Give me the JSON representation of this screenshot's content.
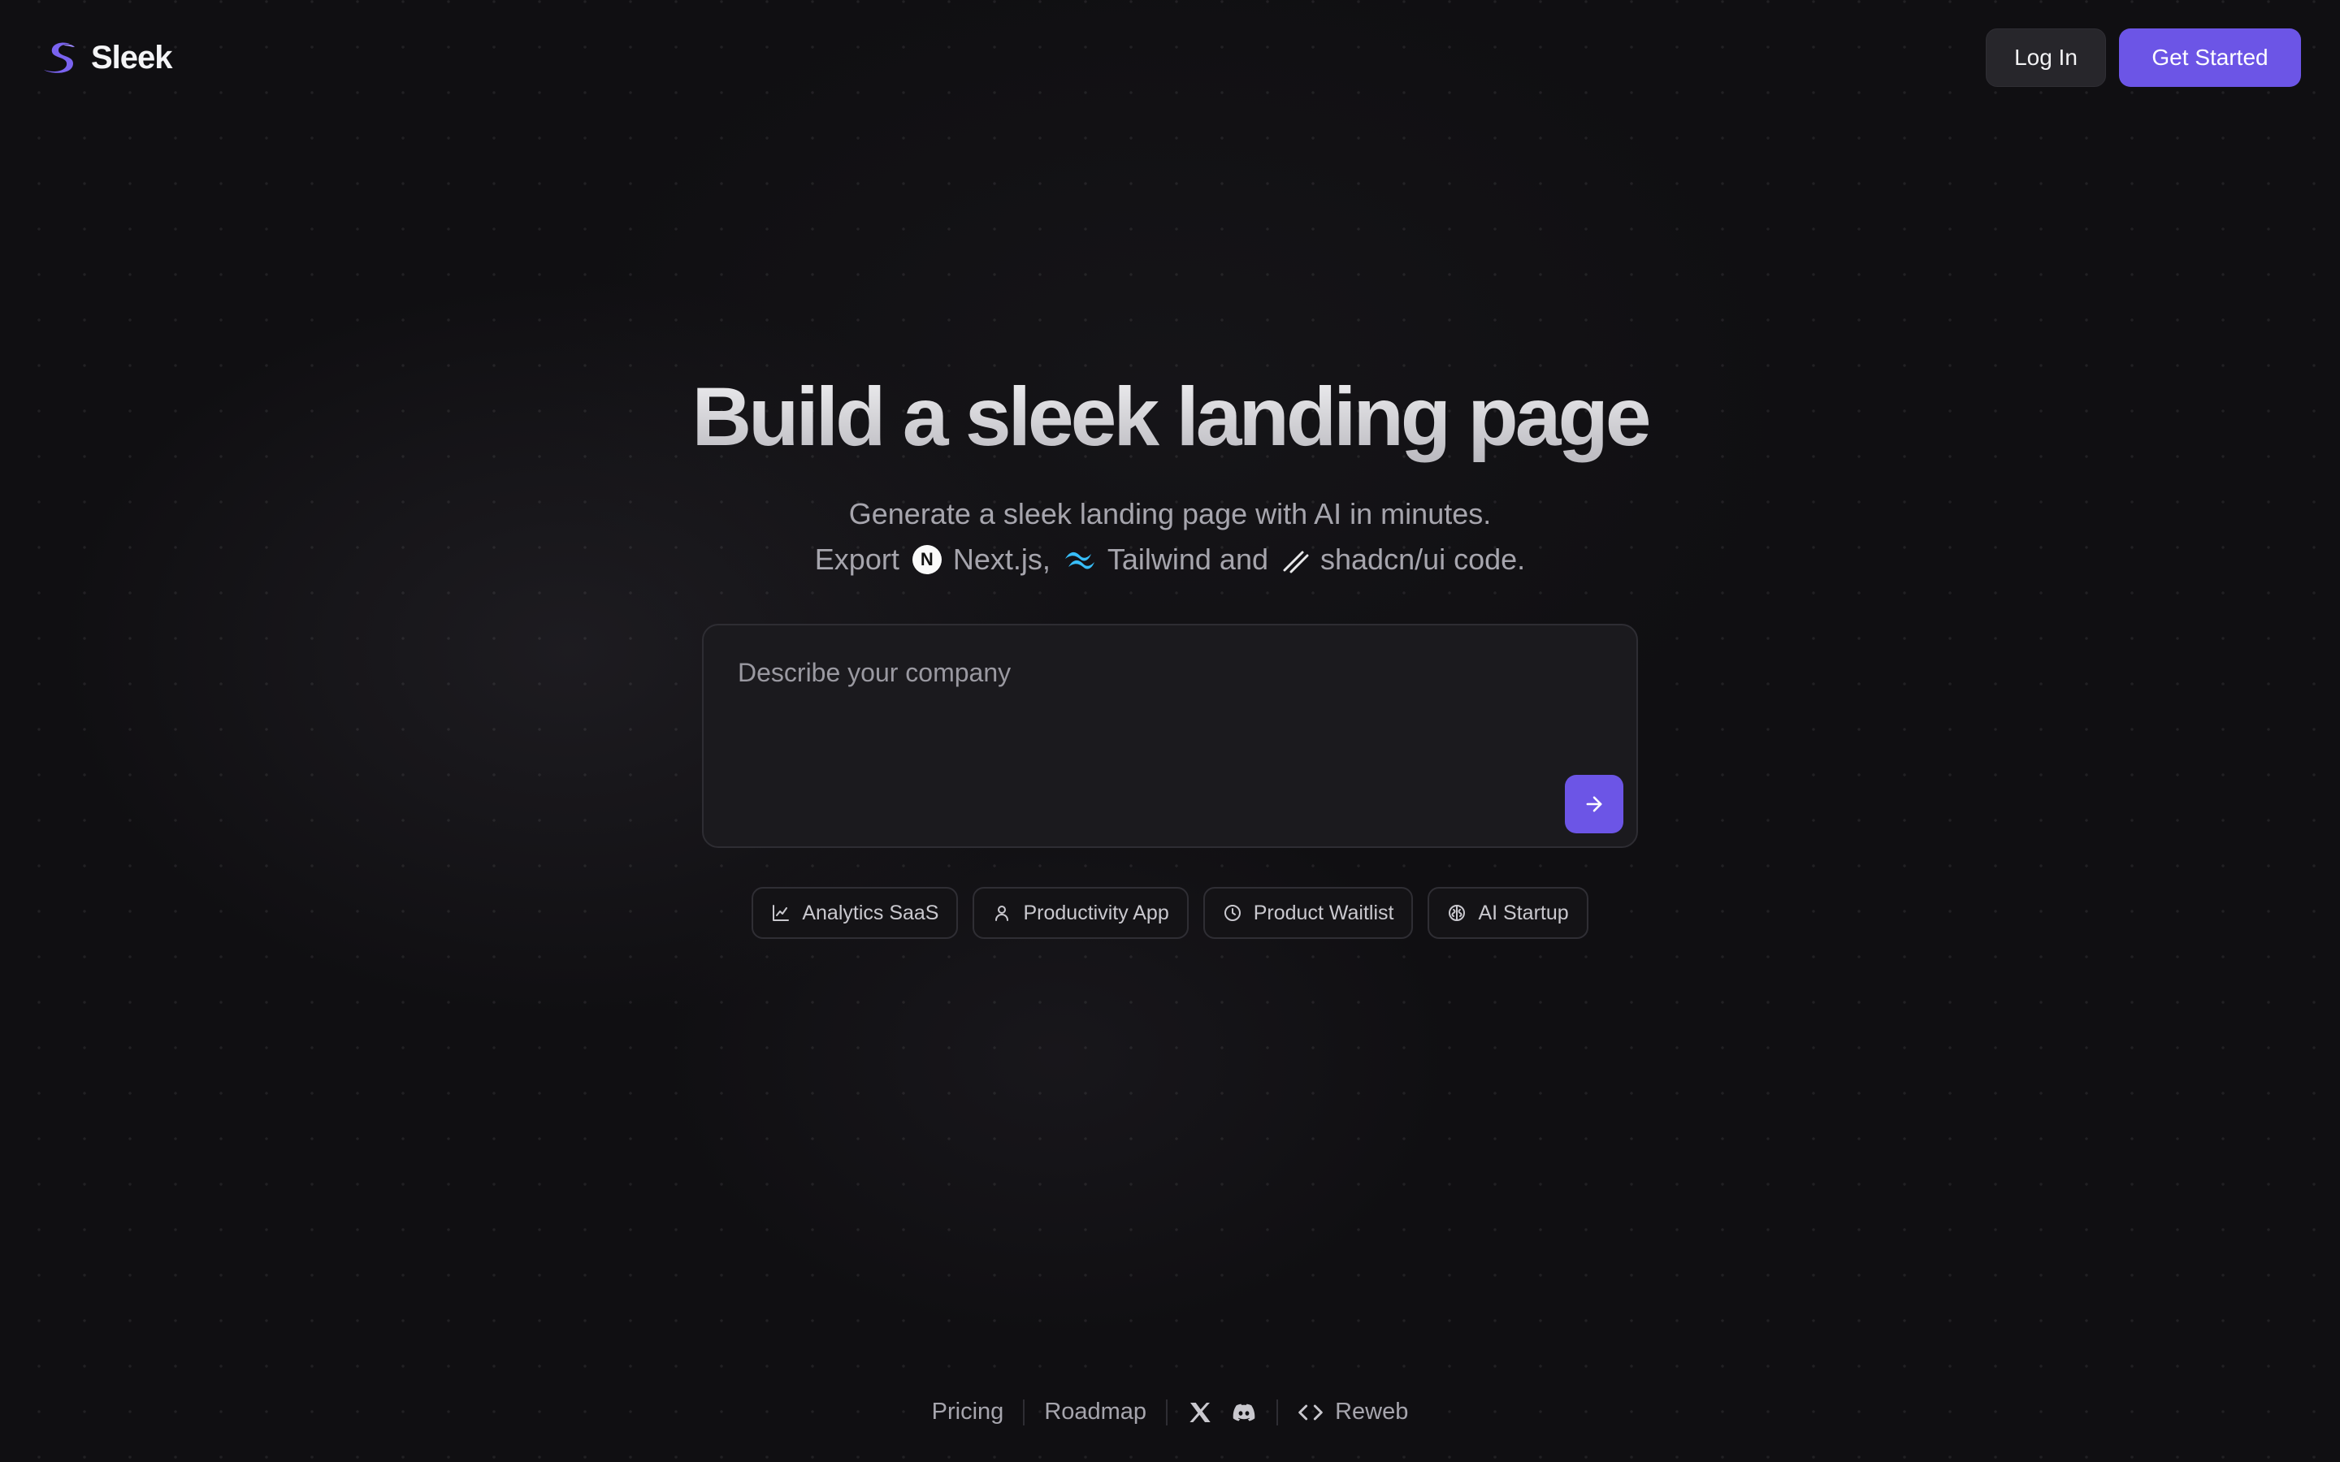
{
  "header": {
    "brand": "Sleek",
    "login_label": "Log In",
    "cta_label": "Get Started"
  },
  "hero": {
    "title": "Build a sleek landing page",
    "subtitle_line1": "Generate a sleek landing page with AI in minutes.",
    "export_prefix": "Export",
    "tech_next": "Next.js,",
    "tech_tailwind": "Tailwind and",
    "tech_shadcn": "shadcn/ui code."
  },
  "prompt": {
    "placeholder": "Describe your company",
    "submit_icon": "arrow-right-icon"
  },
  "suggestions": [
    {
      "label": "Analytics SaaS",
      "icon": "chart-icon"
    },
    {
      "label": "Productivity App",
      "icon": "user-icon"
    },
    {
      "label": "Product Waitlist",
      "icon": "clock-icon"
    },
    {
      "label": "AI Startup",
      "icon": "ai-icon"
    }
  ],
  "footer": {
    "pricing": "Pricing",
    "roadmap": "Roadmap",
    "reweb": "Reweb"
  },
  "colors": {
    "accent": "#6c55e6",
    "background": "#100f12"
  }
}
